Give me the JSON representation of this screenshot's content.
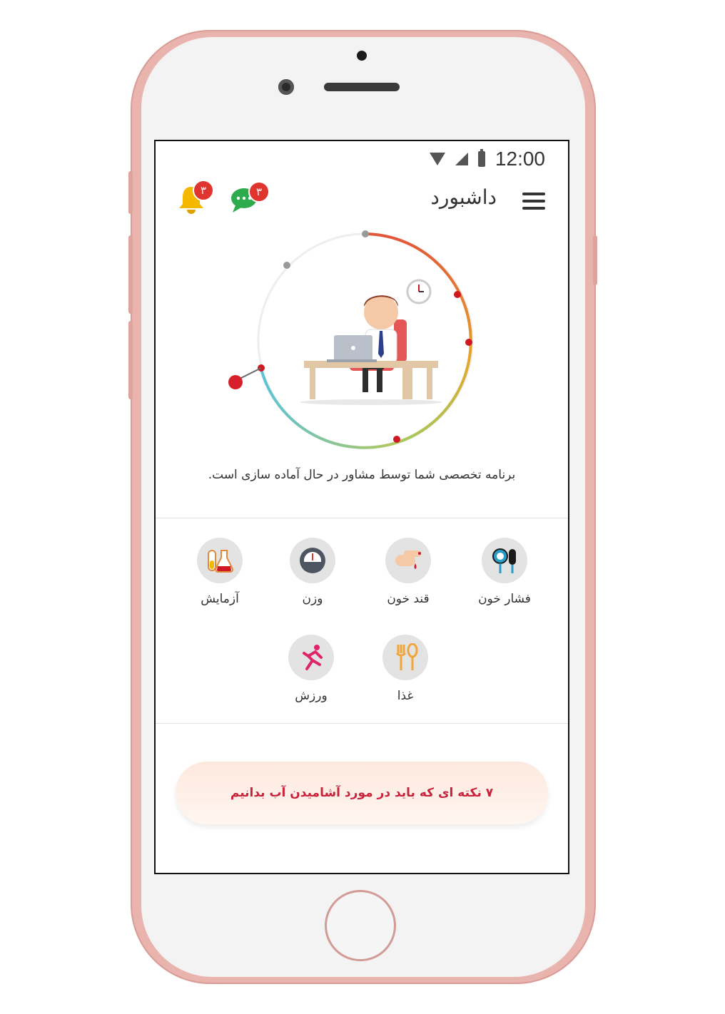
{
  "status_bar": {
    "time": "12:00"
  },
  "header": {
    "title": "داشبورد",
    "notifications_badge": "۳",
    "messages_badge": "۳"
  },
  "hero": {
    "caption": "برنامه تخصصی شما توسط مشاور در حال آماده سازی است."
  },
  "categories": [
    {
      "label": "فشار خون",
      "icon": "blood-pressure-icon"
    },
    {
      "label": "قند خون",
      "icon": "blood-sugar-icon"
    },
    {
      "label": "وزن",
      "icon": "weight-scale-icon"
    },
    {
      "label": "آزمایش",
      "icon": "lab-test-icon"
    },
    {
      "label": "غذا",
      "icon": "food-icon"
    },
    {
      "label": "ورزش",
      "icon": "exercise-icon"
    }
  ],
  "tip": {
    "label": "۷ نکته ای که باید در مورد آشامیدن آب بدانیم"
  },
  "colors": {
    "accent_red": "#e0342f",
    "bell_yellow": "#f5b800",
    "chat_green": "#2eab4c",
    "tip_text": "#c8233b"
  }
}
